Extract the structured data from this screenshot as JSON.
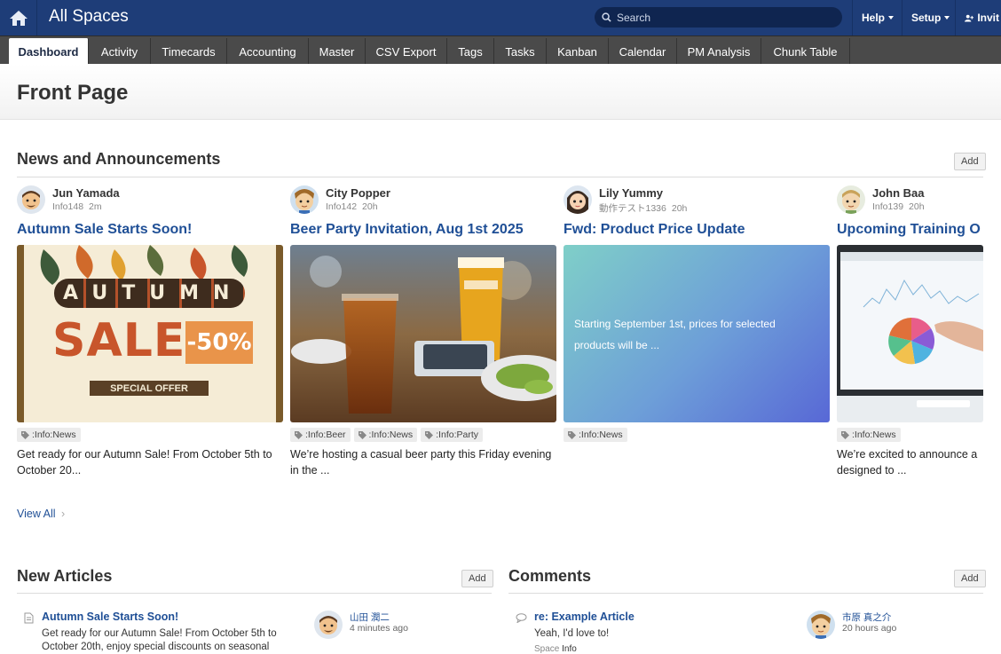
{
  "header": {
    "app_title": "All Spaces",
    "search_placeholder": "Search",
    "menus": {
      "help": "Help",
      "setup": "Setup",
      "invite": "Invit"
    }
  },
  "tabs": [
    "Dashboard",
    "Activity",
    "Timecards",
    "Accounting",
    "Master",
    "CSV Export",
    "Tags",
    "Tasks",
    "Kanban",
    "Calendar",
    "PM Analysis",
    "Chunk Table"
  ],
  "page": {
    "title": "Front Page"
  },
  "news": {
    "title": "News and Announcements",
    "add_label": "Add",
    "view_all": "View All",
    "cards": [
      {
        "author": "Jun Yamada",
        "space": "Info148",
        "time": "2m",
        "title": "Autumn Sale Starts Soon!",
        "tags": [
          ":Info:News"
        ],
        "excerpt": "Get ready for our Autumn Sale! From October 5th to October 20...",
        "image": {
          "word": "AUTUMN",
          "sale": "SALE",
          "discount": "-50%",
          "offer": "SPECIAL OFFER"
        }
      },
      {
        "author": "City Popper",
        "space": "Info142",
        "time": "20h",
        "title": "Beer Party Invitation, Aug 1st 2025",
        "tags": [
          ":Info:Beer",
          ":Info:News",
          ":Info:Party"
        ],
        "excerpt": "We’re hosting a casual beer party this Friday evening in the ..."
      },
      {
        "author": "Lily Yummy",
        "space": "動作テスト1336",
        "time": "20h",
        "title": "Fwd: Product Price Update",
        "tags": [
          ":Info:News"
        ],
        "excerpt": "",
        "image_text": "Starting September 1st, prices for selected products will be ..."
      },
      {
        "author": "John Baa",
        "space": "Info139",
        "time": "20h",
        "title": "Upcoming Training O",
        "tags": [
          ":Info:News"
        ],
        "excerpt": "We’re excited to announce a designed to ..."
      }
    ]
  },
  "articles": {
    "title": "New Articles",
    "add_label": "Add",
    "items": [
      {
        "title": "Autumn Sale Starts Soon!",
        "text": "Get ready for our Autumn Sale! From October 5th to October 20th, enjoy special discounts on seasonal",
        "user": "山田 潤二",
        "time": "4 minutes ago"
      }
    ]
  },
  "comments": {
    "title": "Comments",
    "add_label": "Add",
    "items": [
      {
        "title": "re: Example Article",
        "text": "Yeah, I'd love to!",
        "space_label": "Space",
        "space": "Info",
        "user": "市原 真之介",
        "time": "20 hours ago"
      }
    ]
  },
  "colors": {
    "topbar": "#1e3d78",
    "tabbar": "#4a4a4a",
    "link": "#1f4f96"
  }
}
